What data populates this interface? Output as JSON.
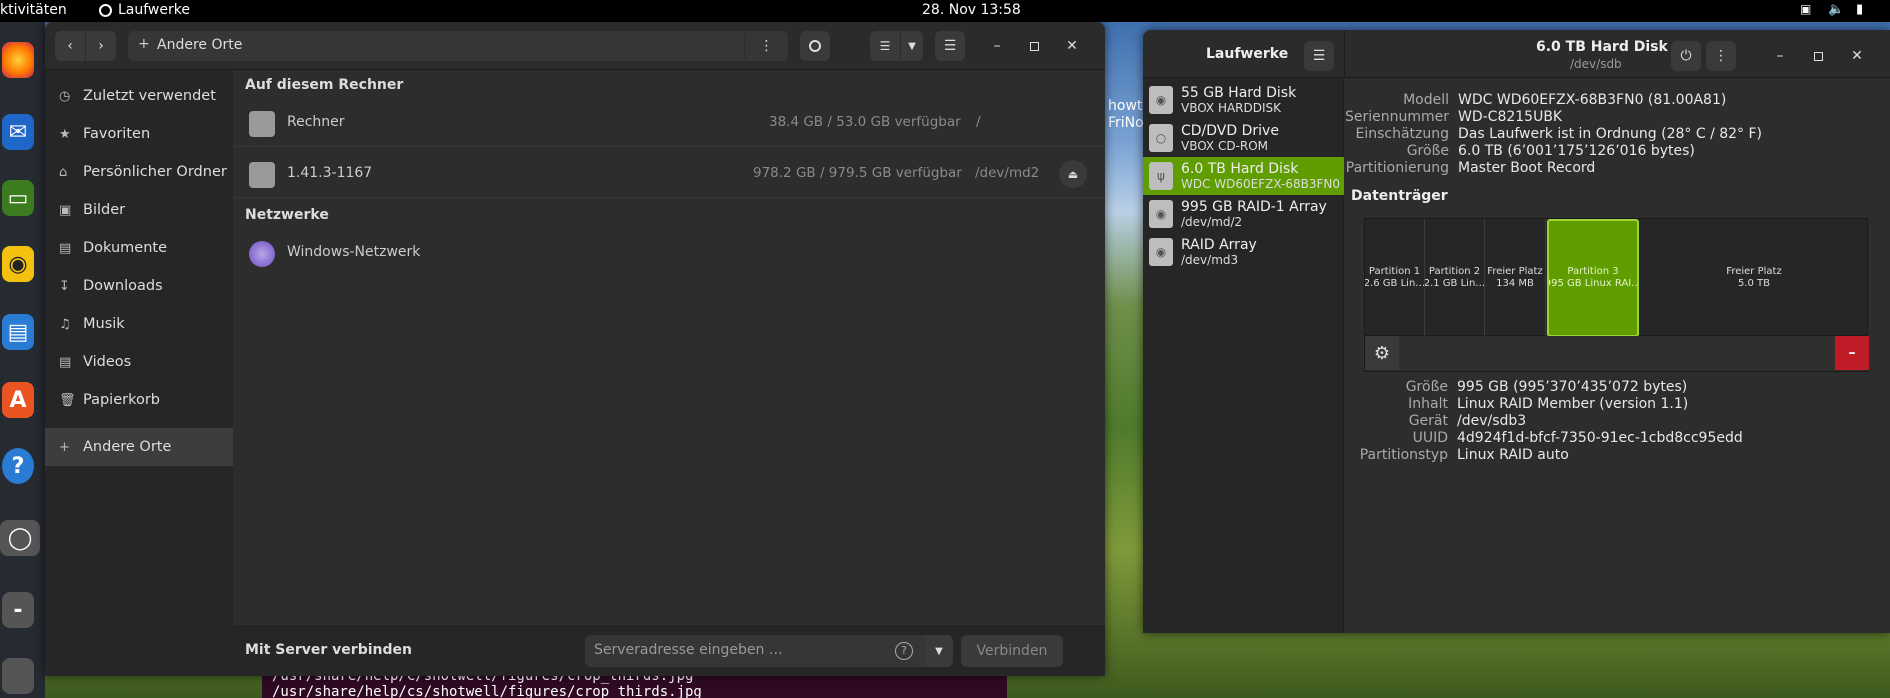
{
  "topbar": {
    "activities": "ktivitäten",
    "app_name": "Laufwerke",
    "clock": "28. Nov  13:58"
  },
  "terminal": {
    "lines": [
      "/usr/share/help/C/shotwell/figures/crop_thirds.jpg",
      "/usr/share/help/cs/shotwell/figures/crop_thirds.jpg"
    ]
  },
  "wallpaper_text": [
    "howt",
    "FriNo"
  ],
  "files": {
    "location": "Andere Orte",
    "sidebar": [
      {
        "icon": "clock-icon",
        "label": "Zuletzt verwendet"
      },
      {
        "icon": "star-icon",
        "label": "Favoriten"
      },
      {
        "icon": "home-icon",
        "label": "Persönlicher Ordner"
      },
      {
        "icon": "image-icon",
        "label": "Bilder"
      },
      {
        "icon": "document-icon",
        "label": "Dokumente"
      },
      {
        "icon": "download-icon",
        "label": "Downloads"
      },
      {
        "icon": "music-icon",
        "label": "Musik"
      },
      {
        "icon": "video-icon",
        "label": "Videos"
      },
      {
        "icon": "trash-icon",
        "label": "Papierkorb"
      },
      {
        "icon": "plus-icon",
        "label": "Andere Orte"
      }
    ],
    "section_local": "Auf diesem Rechner",
    "section_network": "Netzwerke",
    "locations": [
      {
        "name": "Rechner",
        "free": "38.4 GB / 53.0 GB verfügbar",
        "mount": "/"
      },
      {
        "name": "1.41.3-1167",
        "free": "978.2 GB / 979.5 GB verfügbar",
        "mount": "/dev/md2"
      }
    ],
    "network": [
      {
        "name": "Windows-Netzwerk"
      }
    ],
    "connect_label": "Mit Server verbinden",
    "server_placeholder": "Serveradresse eingeben …",
    "connect_button": "Verbinden"
  },
  "disks": {
    "app_title": "Laufwerke",
    "selected_title": "6.0 TB Hard Disk",
    "selected_subtitle": "/dev/sdb",
    "drives": [
      {
        "name": "55 GB Hard Disk",
        "sub": "VBOX HARDDISK"
      },
      {
        "name": "CD/DVD Drive",
        "sub": "VBOX CD-ROM"
      },
      {
        "name": "6.0 TB Hard Disk",
        "sub": "WDC WD60EFZX-68B3FN0"
      },
      {
        "name": "995 GB RAID-1 Array",
        "sub": "/dev/md/2"
      },
      {
        "name": "RAID Array",
        "sub": "/dev/md3"
      }
    ],
    "drive_info": [
      {
        "k": "Modell",
        "v": "WDC WD60EFZX-68B3FN0 (81.00A81)"
      },
      {
        "k": "Seriennummer",
        "v": "WD-C8215UBK"
      },
      {
        "k": "Einschätzung",
        "v": "Das Laufwerk ist in Ordnung (28° C / 82° F)"
      },
      {
        "k": "Größe",
        "v": "6.0 TB (6’001’175’126’016 bytes)"
      },
      {
        "k": "Partitionierung",
        "v": "Master Boot Record"
      }
    ],
    "volumes_label": "Datenträger",
    "partitions": [
      {
        "l1": "Partition 1",
        "l2": "2.6 GB Lin…"
      },
      {
        "l1": "Partition 2",
        "l2": "2.1 GB Lin…"
      },
      {
        "l1": "Freier Platz",
        "l2": "134 MB"
      },
      {
        "l1": "Partition 3",
        "l2": "995 GB Linux RAI…"
      },
      {
        "l1": "Freier Platz",
        "l2": "5.0 TB"
      }
    ],
    "part_info": [
      {
        "k": "Größe",
        "v": "995 GB (995’370’435’072 bytes)"
      },
      {
        "k": "Inhalt",
        "v": "Linux RAID Member (version 1.1)"
      },
      {
        "k": "Gerät",
        "v": "/dev/sdb3"
      },
      {
        "k": "UUID",
        "v": "4d924f1d-bfcf-7350-91ec-1cbd8cc95edd"
      },
      {
        "k": "Partitionstyp",
        "v": "Linux RAID auto"
      }
    ]
  },
  "colors": {
    "accent": "#5f9d00",
    "danger": "#c01c28",
    "terminal": "#300a24"
  }
}
